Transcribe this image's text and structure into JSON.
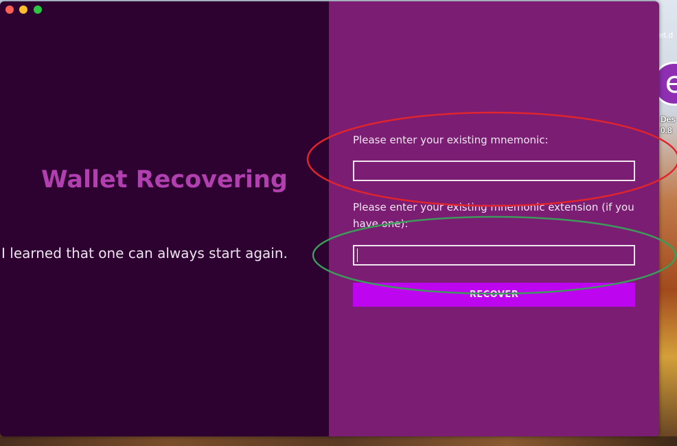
{
  "desktop": {
    "icon_caption": "et.d",
    "icon_glyph": "e",
    "icon_label_line1": "Des",
    "icon_label_line2": "0.8"
  },
  "window": {
    "left_pane": {
      "title": "Wallet Recovering",
      "quote": "I learned that one can always start again."
    },
    "right_pane": {
      "mnemonic_label": "Please enter your existing mnemonic:",
      "mnemonic_value": "",
      "extension_label": "Please enter your existing mnemonic extension (if you have one):",
      "extension_value": "",
      "recover_button": "RECOVER"
    }
  },
  "colors": {
    "left_bg": "#2d0130",
    "right_bg": "#7b1e73",
    "title": "#b13fb0",
    "button": "#bd05f0",
    "annotation_red": "#e0242e",
    "annotation_green": "#3e9a5a"
  }
}
